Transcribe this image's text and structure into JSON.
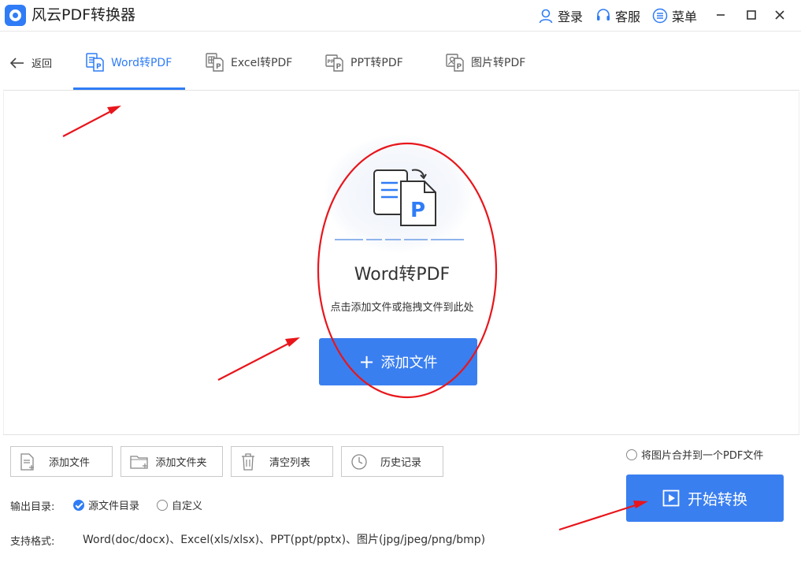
{
  "app": {
    "title": "风云PDF转换器"
  },
  "header": {
    "login_label": "登录",
    "service_label": "客服",
    "menu_label": "菜单"
  },
  "tabs": {
    "back_label": "返回",
    "items": [
      {
        "label": "Word转PDF",
        "active": true,
        "icon": "word-doc-icon"
      },
      {
        "label": "Excel转PDF",
        "active": false,
        "icon": "excel-doc-icon"
      },
      {
        "label": "PPT转PDF",
        "active": false,
        "icon": "ppt-doc-icon"
      },
      {
        "label": "图片转PDF",
        "active": false,
        "icon": "image-doc-icon"
      }
    ]
  },
  "main": {
    "title": "Word转PDF",
    "hint": "点击添加文件或拖拽文件到此处",
    "add_button_label": "添加文件"
  },
  "toolbar": {
    "add_file": "添加文件",
    "add_folder": "添加文件夹",
    "clear_list": "清空列表",
    "history": "历史记录"
  },
  "options": {
    "merge_label": "将图片合并到一个PDF文件",
    "merge_checked": false,
    "output_label": "输出目录:",
    "output_source": "源文件目录",
    "output_source_checked": true,
    "output_custom": "自定义",
    "output_custom_checked": false
  },
  "formats": {
    "label": "支持格式:",
    "value": "Word(doc/docx)、Excel(xls/xlsx)、PPT(ppt/pptx)、图片(jpg/jpeg/png/bmp)"
  },
  "start_button_label": "开始转换",
  "colors": {
    "accent": "#2f7cf6",
    "button": "#3a7ff0",
    "annotation_red": "#e8151b"
  }
}
